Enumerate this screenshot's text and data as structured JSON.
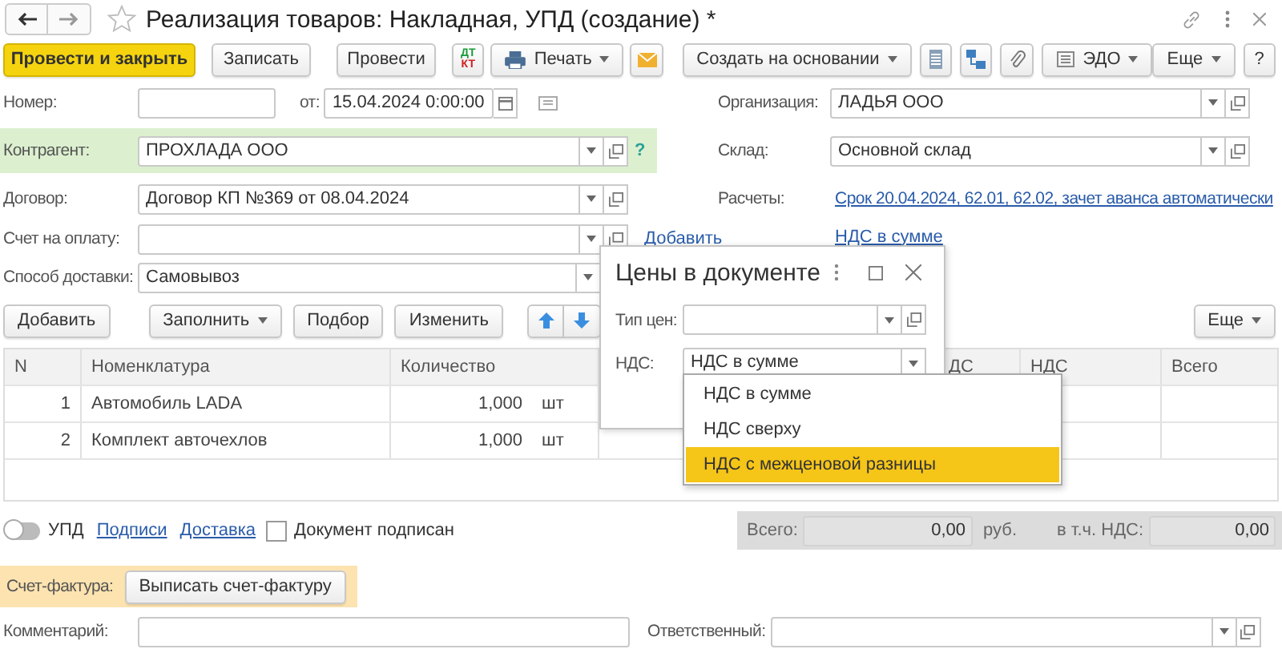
{
  "window": {
    "title": "Реализация товаров: Накладная, УПД (создание) *"
  },
  "toolbar": {
    "post_close": "Провести и закрыть",
    "save": "Записать",
    "post": "Провести",
    "dt": "ДТ",
    "kt": "КТ",
    "print": "Печать",
    "create_based": "Создать на основании",
    "edo": "ЭДО",
    "more": "Еще",
    "help": "?"
  },
  "number": {
    "label": "Номер:"
  },
  "date": {
    "label": "от:",
    "value": "15.04.2024  0:00:00"
  },
  "counterparty": {
    "label": "Контрагент:",
    "value": "ПРОХЛАДА ООО",
    "help": "?"
  },
  "contract": {
    "label": "Договор:",
    "value": "Договор КП №369 от 08.04.2024"
  },
  "invoice_for_payment": {
    "label": "Счет на оплату:",
    "link": "Добавить"
  },
  "delivery": {
    "label": "Способ доставки:",
    "value": "Самовывоз"
  },
  "organization": {
    "label": "Организация:",
    "value": "ЛАДЬЯ ООО"
  },
  "warehouse": {
    "label": "Склад:",
    "value": "Основной склад"
  },
  "settlements": {
    "label": "Расчеты:",
    "link": "Срок 20.04.2024, 62.01, 62.02, зачет аванса автоматически"
  },
  "vat_link": "НДС в сумме",
  "table_toolbar": {
    "add": "Добавить",
    "fill": "Заполнить",
    "pick": "Подбор",
    "edit": "Изменить",
    "more": "Еще"
  },
  "table": {
    "columns": [
      "N",
      "Номенклатура",
      "Количество",
      "ДС",
      "НДС",
      "Всего"
    ],
    "rows": [
      {
        "n": "1",
        "item": "Автомобиль LADA",
        "quantity": "1,000",
        "unit": "шт"
      },
      {
        "n": "2",
        "item": "Комплект авточехлов",
        "quantity": "1,000",
        "unit": "шт"
      }
    ]
  },
  "footer": {
    "upd": {
      "label": "УПД",
      "on": false
    },
    "links": [
      "Подписи",
      "Доставка"
    ],
    "signed": {
      "label": "Документ подписан",
      "checked": false
    },
    "totals": {
      "total_label": "Всего:",
      "total": "0,00",
      "currency": "руб.",
      "vat_label": "в т.ч. НДС:",
      "vat": "0,00"
    },
    "invoice": {
      "label": "Счет-фактура:",
      "button": "Выписать счет-фактуру"
    },
    "comment": {
      "label": "Комментарий:"
    },
    "responsible": {
      "label": "Ответственный:"
    }
  },
  "dialog": {
    "title": "Цены в документе",
    "price_type": {
      "label": "Тип цен:"
    },
    "vat": {
      "label": "НДС:",
      "value": "НДС в сумме"
    },
    "options": [
      {
        "label": "НДС в сумме",
        "selected": false
      },
      {
        "label": "НДС сверху",
        "selected": false
      },
      {
        "label": "НДС с межценовой разницы",
        "selected": true
      }
    ]
  }
}
